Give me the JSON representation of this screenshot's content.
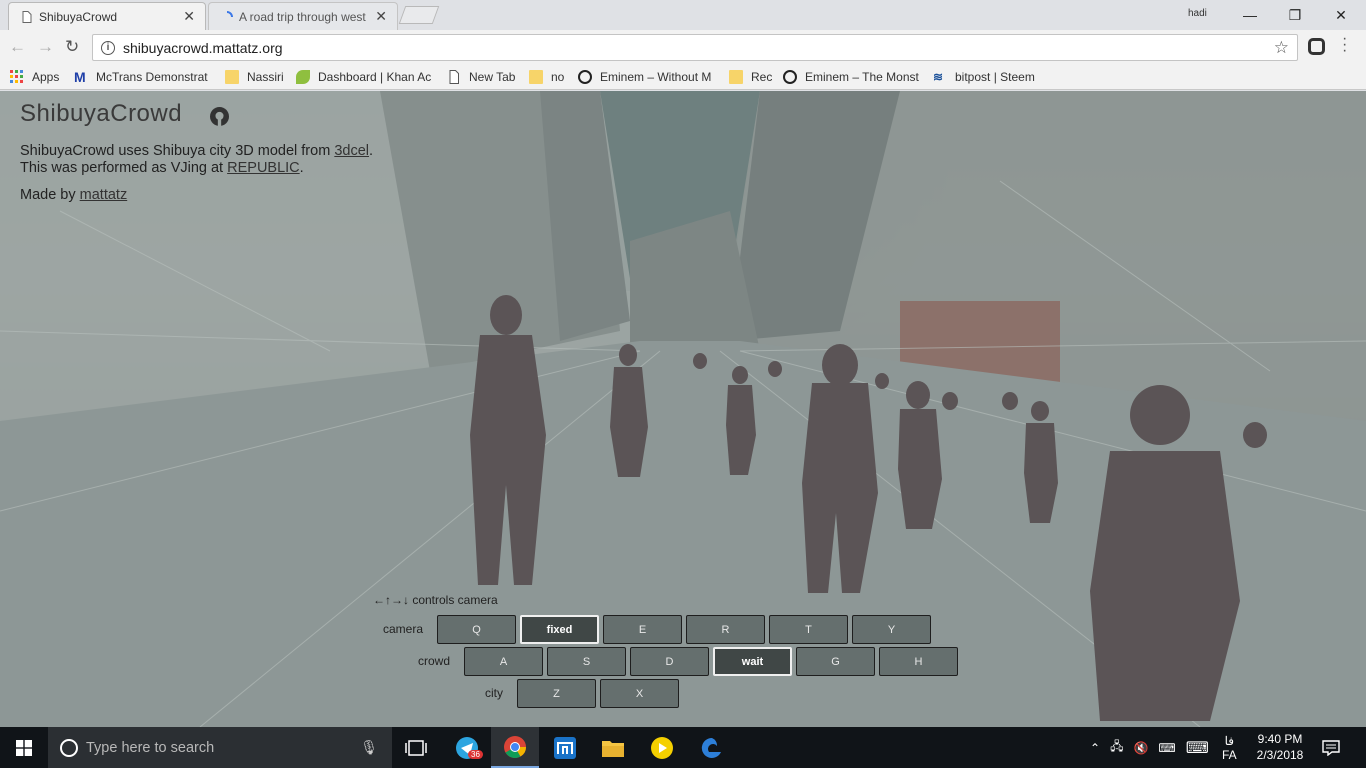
{
  "browser": {
    "tabs": [
      {
        "title": "ShibuyaCrowd",
        "active": true
      },
      {
        "title": "A road trip through west",
        "active": false
      }
    ],
    "profile_name": "hadi",
    "url": "shibuyacrowd.mattatz.org",
    "window_controls": {
      "minimize": "—",
      "restore": "❐",
      "close": "✕"
    },
    "bookmarks": [
      {
        "label": "Apps",
        "icon": "apps-grid-icon"
      },
      {
        "label": "McTrans Demonstrat",
        "icon": "mctrans-icon"
      },
      {
        "label": "Nassiri",
        "icon": "folder-icon"
      },
      {
        "label": "Dashboard | Khan Ac",
        "icon": "khan-academy-icon"
      },
      {
        "label": "New Tab",
        "icon": "page-icon"
      },
      {
        "label": "no",
        "icon": "folder-icon"
      },
      {
        "label": "Eminem – Without M",
        "icon": "emoji-icon"
      },
      {
        "label": "Rec",
        "icon": "folder-icon"
      },
      {
        "label": "Eminem – The Monst",
        "icon": "emoji-icon"
      },
      {
        "label": "bitpost | Steem",
        "icon": "steem-icon"
      }
    ]
  },
  "page": {
    "title": "ShibuyaCrowd",
    "line1_prefix": "ShibuyaCrowd uses Shibuya city 3D model from ",
    "line1_link": "3dcel",
    "line1_suffix": ".",
    "line2_prefix": "This was performed as VJing at ",
    "line2_link": "REPUBLIC",
    "line2_suffix": ".",
    "made_by_prefix": "Made by ",
    "made_by_link": "mattatz",
    "controls_hint": "←↑→↓ controls camera",
    "camera": {
      "label": "camera",
      "keys": [
        "Q",
        "fixed",
        "E",
        "R",
        "T",
        "Y"
      ],
      "active": "fixed"
    },
    "crowd": {
      "label": "crowd",
      "keys": [
        "A",
        "S",
        "D",
        "wait",
        "G",
        "H"
      ],
      "active": "wait"
    },
    "city": {
      "label": "city",
      "keys": [
        "Z",
        "X"
      ]
    }
  },
  "taskbar": {
    "search_placeholder": "Type here to search",
    "telegram_badge": "36",
    "language_top": "فا",
    "language": "FA",
    "time": "9:40 PM",
    "date": "2/3/2018"
  }
}
